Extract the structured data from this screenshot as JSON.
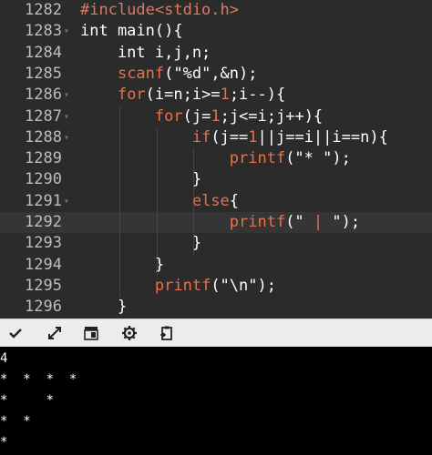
{
  "editor": {
    "lines": [
      {
        "num": "1282",
        "fold": "",
        "tokens": [
          {
            "t": "#include<stdio.h>",
            "c": "pre"
          }
        ]
      },
      {
        "num": "1283",
        "fold": "▾",
        "tokens": [
          {
            "t": "int main(){",
            "c": "kw"
          }
        ]
      },
      {
        "num": "1284",
        "fold": "",
        "tokens": [
          {
            "t": "    int i,j,n;",
            "c": "kw"
          }
        ]
      },
      {
        "num": "1285",
        "fold": "",
        "tokens": [
          {
            "t": "    ",
            "c": "kw"
          },
          {
            "t": "scanf",
            "c": "fn"
          },
          {
            "t": "(\"%d\",&n);",
            "c": "str"
          }
        ]
      },
      {
        "num": "1286",
        "fold": "▾",
        "tokens": [
          {
            "t": "    ",
            "c": "kw"
          },
          {
            "t": "for",
            "c": "op"
          },
          {
            "t": "(i=n;i>=",
            "c": "kw"
          },
          {
            "t": "1",
            "c": "op"
          },
          {
            "t": ";i--){",
            "c": "kw"
          }
        ]
      },
      {
        "num": "1287",
        "fold": "▾",
        "tokens": [
          {
            "t": "        ",
            "c": "kw"
          },
          {
            "t": "for",
            "c": "op"
          },
          {
            "t": "(j=",
            "c": "kw"
          },
          {
            "t": "1",
            "c": "op"
          },
          {
            "t": ";j<=i;j++){",
            "c": "kw"
          }
        ]
      },
      {
        "num": "1288",
        "fold": "▾",
        "tokens": [
          {
            "t": "            ",
            "c": "kw"
          },
          {
            "t": "if",
            "c": "op"
          },
          {
            "t": "(j==",
            "c": "kw"
          },
          {
            "t": "1",
            "c": "op"
          },
          {
            "t": "||j==i||i==n){",
            "c": "kw"
          }
        ]
      },
      {
        "num": "1289",
        "fold": "",
        "tokens": [
          {
            "t": "                ",
            "c": "kw"
          },
          {
            "t": "printf",
            "c": "fn"
          },
          {
            "t": "(\"* \");",
            "c": "str"
          }
        ]
      },
      {
        "num": "1290",
        "fold": "",
        "tokens": [
          {
            "t": "            }",
            "c": "kw"
          }
        ]
      },
      {
        "num": "1291",
        "fold": "▾",
        "tokens": [
          {
            "t": "            ",
            "c": "kw"
          },
          {
            "t": "else",
            "c": "op"
          },
          {
            "t": "{",
            "c": "kw"
          }
        ]
      },
      {
        "num": "1292",
        "fold": "",
        "active": true,
        "tokens": [
          {
            "t": "                ",
            "c": "kw"
          },
          {
            "t": "printf",
            "c": "fn"
          },
          {
            "t": "(\" ",
            "c": "str"
          },
          {
            "t": "|",
            "c": "op"
          },
          {
            "t": " \");",
            "c": "str"
          }
        ]
      },
      {
        "num": "1293",
        "fold": "",
        "tokens": [
          {
            "t": "            }",
            "c": "kw"
          }
        ]
      },
      {
        "num": "1294",
        "fold": "",
        "tokens": [
          {
            "t": "        }",
            "c": "kw"
          }
        ]
      },
      {
        "num": "1295",
        "fold": "",
        "tokens": [
          {
            "t": "        ",
            "c": "kw"
          },
          {
            "t": "printf",
            "c": "fn"
          },
          {
            "t": "(\"\\n\");",
            "c": "str"
          }
        ]
      },
      {
        "num": "1296",
        "fold": "",
        "tokens": [
          {
            "t": "    }",
            "c": "kw"
          }
        ]
      }
    ]
  },
  "toolbar": {
    "buttons": [
      {
        "name": "check-button",
        "icon": "check-icon"
      },
      {
        "name": "expand-button",
        "icon": "expand-icon"
      },
      {
        "name": "layout-button",
        "icon": "layout-icon"
      },
      {
        "name": "settings-button",
        "icon": "gear-icon"
      },
      {
        "name": "copy-button",
        "icon": "clipboard-icon"
      }
    ]
  },
  "console": {
    "lines": [
      "4",
      "*  *  *  *",
      "*     *",
      "*  *",
      "*"
    ]
  },
  "colors": {
    "editor_bg": "#2b2b2b",
    "keyword": "#e8704d",
    "toolbar_bg": "#ececec",
    "console_bg": "#000000"
  }
}
